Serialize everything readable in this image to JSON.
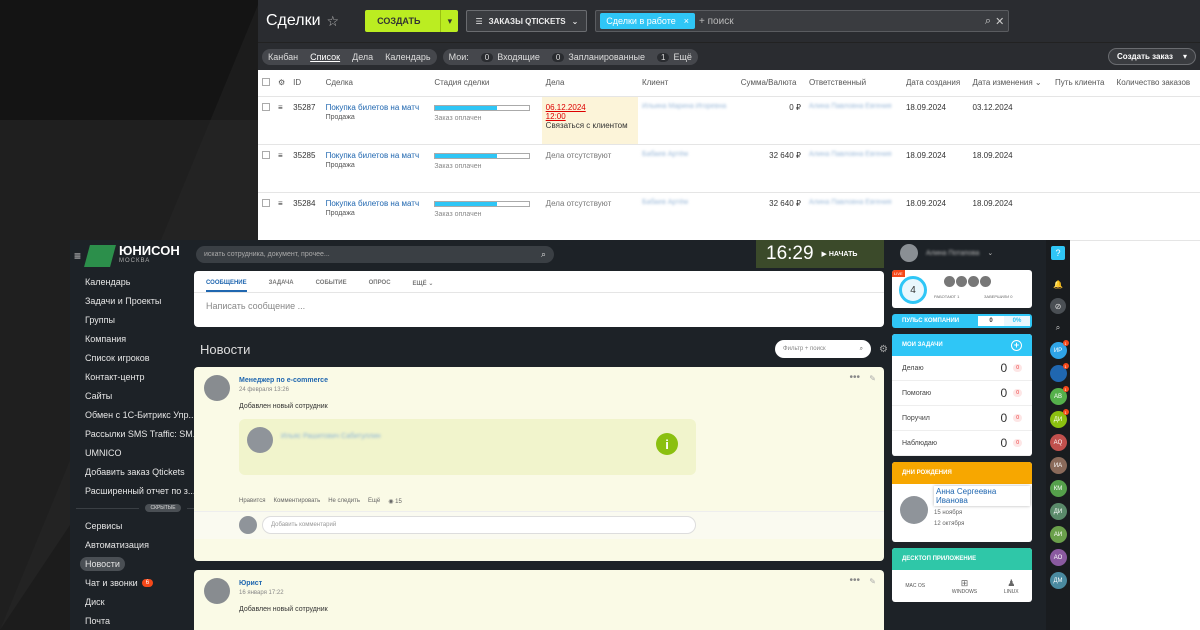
{
  "deals": {
    "title": "Сделки",
    "create_label": "СОЗДАТЬ",
    "filter_label": "ЗАКАЗЫ QTICKETS",
    "filter_chip": "Сделки в работе",
    "search_placeholder": "+ поиск",
    "views": [
      "Канбан",
      "Список",
      "Дела",
      "Календарь"
    ],
    "active_view": "Список",
    "my_label": "Мои:",
    "counters": [
      {
        "count": "0",
        "label": "Входящие"
      },
      {
        "count": "0",
        "label": "Запланированные"
      },
      {
        "count": "1",
        "label": "Ещё"
      }
    ],
    "order_button": "Создать заказ",
    "columns": [
      "ID",
      "Сделка",
      "Стадия сделки",
      "Дела",
      "Клиент",
      "Сумма/Валюта",
      "Ответственный",
      "Дата создания",
      "Дата изменения",
      "Путь клиента",
      "Количество заказов"
    ],
    "rows": [
      {
        "id": "35287",
        "name": "Покупка билетов на матч",
        "sub": "Продажа",
        "stage": "Заказ оплачен",
        "task_date": "06.12.2024",
        "task_time": "12:00",
        "task_text": "Связаться с клиентом",
        "client": "Ильина Марина Игоревна",
        "amount": "0 ₽",
        "owner": "Алина Павловна Евгения",
        "created": "18.09.2024",
        "modified": "03.12.2024"
      },
      {
        "id": "35285",
        "name": "Покупка билетов на матч",
        "sub": "Продажа",
        "stage": "Заказ оплачен",
        "task_text": "Дела отсутствуют",
        "client": "Бабаев Артём",
        "amount": "32 640 ₽",
        "owner": "Алина Павловна Евгения",
        "created": "18.09.2024",
        "modified": "18.09.2024"
      },
      {
        "id": "35284",
        "name": "Покупка билетов на матч",
        "sub": "Продажа",
        "stage": "Заказ оплачен",
        "task_text": "Дела отсутствуют",
        "client": "Бабаев Артём",
        "amount": "32 640 ₽",
        "owner": "Алина Павловна Евгения",
        "created": "18.09.2024",
        "modified": "18.09.2024"
      }
    ]
  },
  "portal": {
    "logo_text": "ЮНИСОН",
    "logo_sub": "МОСКВА",
    "menu": [
      "Календарь",
      "Задачи и Проекты",
      "Группы",
      "Компания",
      "Список игроков",
      "Контакт-центр",
      "Сайты",
      "Обмен с 1С-Битрикс Упр...",
      "Рассылки SMS Traffic: SM...",
      "UMNICO",
      "Добавить заказ Qtickets",
      "Расширенный отчет по з..."
    ],
    "hidden_label": "СКРЫТЫЕ",
    "menu2": [
      "Сервисы",
      "Автоматизация",
      "Новости",
      "Чат и звонки",
      "Диск",
      "Почта"
    ],
    "active_menu": "Новости",
    "chat_badge": "6",
    "search_placeholder": "искать сотрудника, документ, прочее...",
    "clock": "16:29",
    "start_label": "НАЧАТЬ",
    "user_name": "Алина Потапова",
    "composer_tabs": [
      "СООБЩЕНИЕ",
      "ЗАДАЧА",
      "СОБЫТИЕ",
      "ОПРОС",
      "ЕЩЁ"
    ],
    "composer_placeholder": "Написать сообщение ...",
    "news_title": "Новости",
    "filter_placeholder": "Фильтр + поиск",
    "posts": [
      {
        "author": "Менеджер по e-commerce",
        "date": "24 февраля 13:26",
        "text": "Добавлен новый сотрудник",
        "card_name": "Ильяс Рашитович Сабитуллин",
        "actions": [
          "Нравится",
          "Комментировать",
          "Не следить",
          "Ещё"
        ],
        "views": "15",
        "comment_placeholder": "Добавить комментарий"
      },
      {
        "author": "Юрист",
        "date": "16 января 17:22",
        "text": "Добавлен новый сотрудник"
      }
    ]
  },
  "widgets": {
    "live": "LIVE",
    "work_count": "4",
    "worked_label": "РАБОТАЮТ 1",
    "finished_label": "ЗАВЕРШИЛИ 0",
    "pulse_label": "ПУЛЬС КОМПАНИИ",
    "pulse_value": "0",
    "pulse_percent": "0%",
    "tasks_title": "МОИ ЗАДАЧИ",
    "tasks": [
      {
        "label": "Делаю",
        "count": "0",
        "overdue": "0"
      },
      {
        "label": "Помогаю",
        "count": "0",
        "overdue": "0"
      },
      {
        "label": "Поручил",
        "count": "0",
        "overdue": "0"
      },
      {
        "label": "Наблюдаю",
        "count": "0",
        "overdue": "0"
      }
    ],
    "bday_title": "ДНИ РОЖДЕНИЯ",
    "bday_name": "Анна Сергеевна Иванова",
    "bday_d1": "15 ноября",
    "bday_d2": "12 октября",
    "desktop_title": "ДЕСКТОП ПРИЛОЖЕНИЕ",
    "desktop_os": [
      "MAC OS",
      "WINDOWS",
      "LINUX"
    ]
  },
  "iconbar": {
    "users": [
      {
        "initials": "ИР",
        "color": "#2fa4e7",
        "badge": "1"
      },
      {
        "initials": "",
        "color": "#2067b0",
        "badge": "1"
      },
      {
        "initials": "АВ",
        "color": "#55b04b",
        "badge": "1"
      },
      {
        "initials": "ДИ",
        "color": "#8bc010",
        "badge": "1"
      },
      {
        "initials": "AQ",
        "color": "#c0504d",
        "badge": ""
      },
      {
        "initials": "ИА",
        "color": "#8a6a5a",
        "badge": ""
      },
      {
        "initials": "КМ",
        "color": "#55a04b",
        "badge": ""
      },
      {
        "initials": "ДИ",
        "color": "#5a8a6a",
        "badge": ""
      },
      {
        "initials": "АИ",
        "color": "#6aa04b",
        "badge": ""
      },
      {
        "initials": "АО",
        "color": "#8a5aa0",
        "badge": ""
      },
      {
        "initials": "ДМ",
        "color": "#4a8aa0",
        "badge": ""
      }
    ]
  }
}
